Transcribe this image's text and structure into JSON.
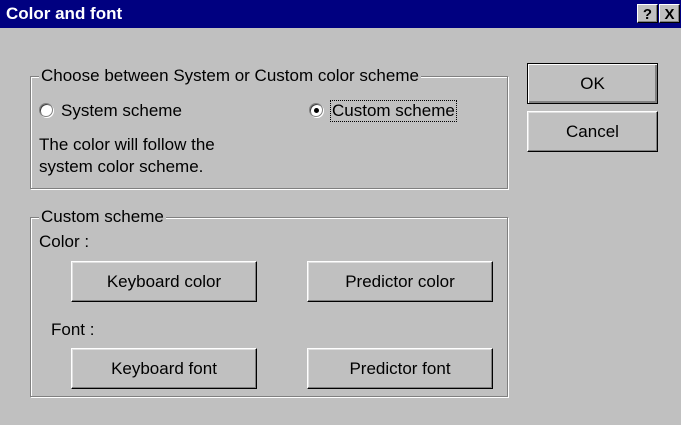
{
  "window": {
    "title": "Color and font",
    "help_label": "?",
    "close_label": "X"
  },
  "scheme_group": {
    "legend": "Choose between System or Custom color scheme",
    "system_option": "System scheme",
    "custom_option": "Custom scheme",
    "selected": "custom",
    "description_line1": "The color will follow the",
    "description_line2": "system color scheme."
  },
  "custom_group": {
    "legend": "Custom scheme",
    "color_label": "Color :",
    "font_label": "Font :",
    "keyboard_color_button": "Keyboard color",
    "predictor_color_button": "Predictor color",
    "keyboard_font_button": "Keyboard font",
    "predictor_font_button": "Predictor font"
  },
  "actions": {
    "ok_label": "OK",
    "cancel_label": "Cancel"
  }
}
